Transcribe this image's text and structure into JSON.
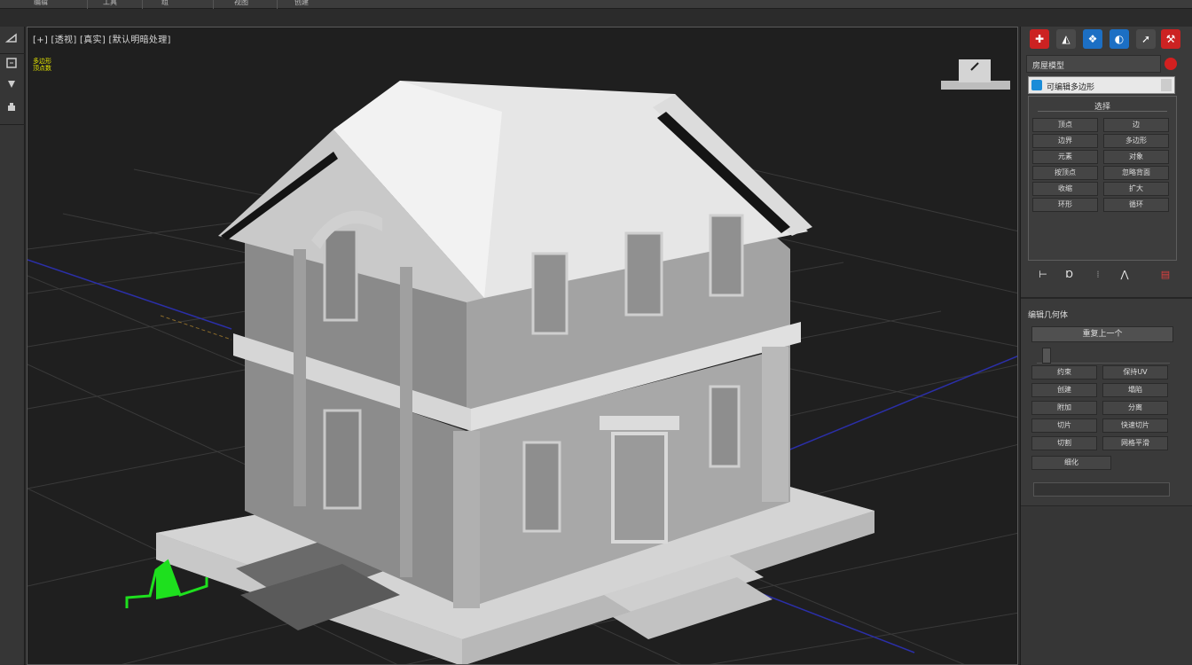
{
  "menubar": {
    "items": [
      "编辑",
      "工具",
      "组",
      "视图",
      "创建",
      "修改器"
    ]
  },
  "left_toolbar": {
    "icons": [
      "select-icon",
      "move-icon",
      "rotate-icon",
      "scale-icon"
    ]
  },
  "viewport": {
    "label": "[+] [透视] [真实] [默认明暗处理]",
    "stats": [
      "多边形",
      "顶点数"
    ],
    "grid_color": "#3a3a3a",
    "axis_blue": "#2b2fa8",
    "gizmo_color": "#1ee01e"
  },
  "command_panel": {
    "tabs": [
      "create-icon",
      "modify-icon",
      "hierarchy-icon",
      "motion-icon",
      "display-icon",
      "utilities-icon"
    ],
    "object_name": "房屋模型",
    "object_color": "#d32020",
    "modifier_list": "可编辑多边形",
    "rollout1": {
      "title": "选择",
      "buttons": [
        "顶点",
        "边",
        "边界",
        "多边形",
        "元素",
        "对象",
        "按顶点",
        "忽略背面",
        "收缩",
        "扩大",
        "环形",
        "循环"
      ]
    },
    "stack_icons": [
      "pin-stack-icon",
      "show-end-result-icon",
      "make-unique-icon",
      "remove-modifier-icon",
      "configure-sets-icon"
    ],
    "rollout2": {
      "title": "编辑几何体",
      "wide_button": "重复上一个",
      "buttons": [
        "约束",
        "保持UV",
        "创建",
        "塌陷",
        "附加",
        "分离",
        "切片",
        "快速切片",
        "切割",
        "网格平滑"
      ],
      "bottom_label": "细化"
    }
  }
}
